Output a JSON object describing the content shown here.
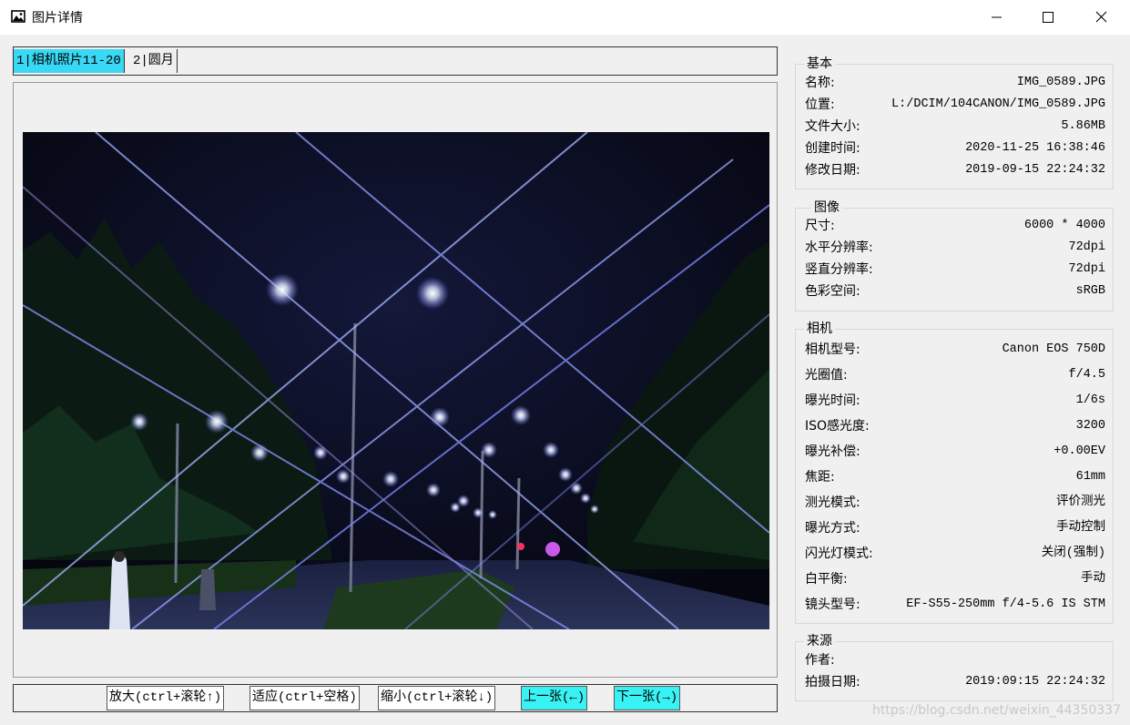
{
  "window": {
    "title": "图片详情"
  },
  "tabs": [
    {
      "label": "1|相机照片11-20",
      "active": true
    },
    {
      "label": "2|圆月",
      "active": false
    }
  ],
  "buttons": {
    "zoom_in": "放大(ctrl+滚轮↑)",
    "fit": "适应(ctrl+空格)",
    "zoom_out": "缩小(ctrl+滚轮↓)",
    "prev": "上一张(←)",
    "next": "下一张(→)"
  },
  "info": {
    "basic": {
      "title": "基本",
      "rows": [
        {
          "label": "名称:",
          "value": "IMG_0589.JPG"
        },
        {
          "label": "位置:",
          "value": "L:/DCIM/104CANON/IMG_0589.JPG"
        },
        {
          "label": "文件大小:",
          "value": "5.86MB"
        },
        {
          "label": "创建时间:",
          "value": "2020-11-25 16:38:46"
        },
        {
          "label": "修改日期:",
          "value": "2019-09-15 22:24:32"
        }
      ]
    },
    "image": {
      "title": "图像",
      "rows": [
        {
          "label": "尺寸:",
          "value": "6000 * 4000"
        },
        {
          "label": "水平分辨率:",
          "value": "72dpi"
        },
        {
          "label": "竖直分辨率:",
          "value": "72dpi"
        },
        {
          "label": "色彩空间:",
          "value": "sRGB"
        }
      ]
    },
    "camera": {
      "title": "相机",
      "rows": [
        {
          "label": "相机型号:",
          "value": "Canon EOS 750D"
        },
        {
          "label": "光圈值:",
          "value": "f/4.5"
        },
        {
          "label": "曝光时间:",
          "value": "1/6s"
        },
        {
          "label": "ISO感光度:",
          "value": "3200"
        },
        {
          "label": "曝光补偿:",
          "value": "+0.00EV"
        },
        {
          "label": "焦距:",
          "value": "61mm"
        },
        {
          "label": "测光模式:",
          "value": "评价测光"
        },
        {
          "label": "曝光方式:",
          "value": "手动控制"
        },
        {
          "label": "闪光灯模式:",
          "value": "关闭(强制)"
        },
        {
          "label": "白平衡:",
          "value": "手动"
        },
        {
          "label": "镜头型号:",
          "value": "EF-S55-250mm f/4-5.6 IS STM"
        }
      ]
    },
    "source": {
      "title": "来源",
      "rows": [
        {
          "label": "作者:",
          "value": ""
        },
        {
          "label": "拍摄日期:",
          "value": "2019:09:15 22:24:32"
        }
      ]
    }
  },
  "watermark": "https://blog.csdn.net/weixin_44350337"
}
